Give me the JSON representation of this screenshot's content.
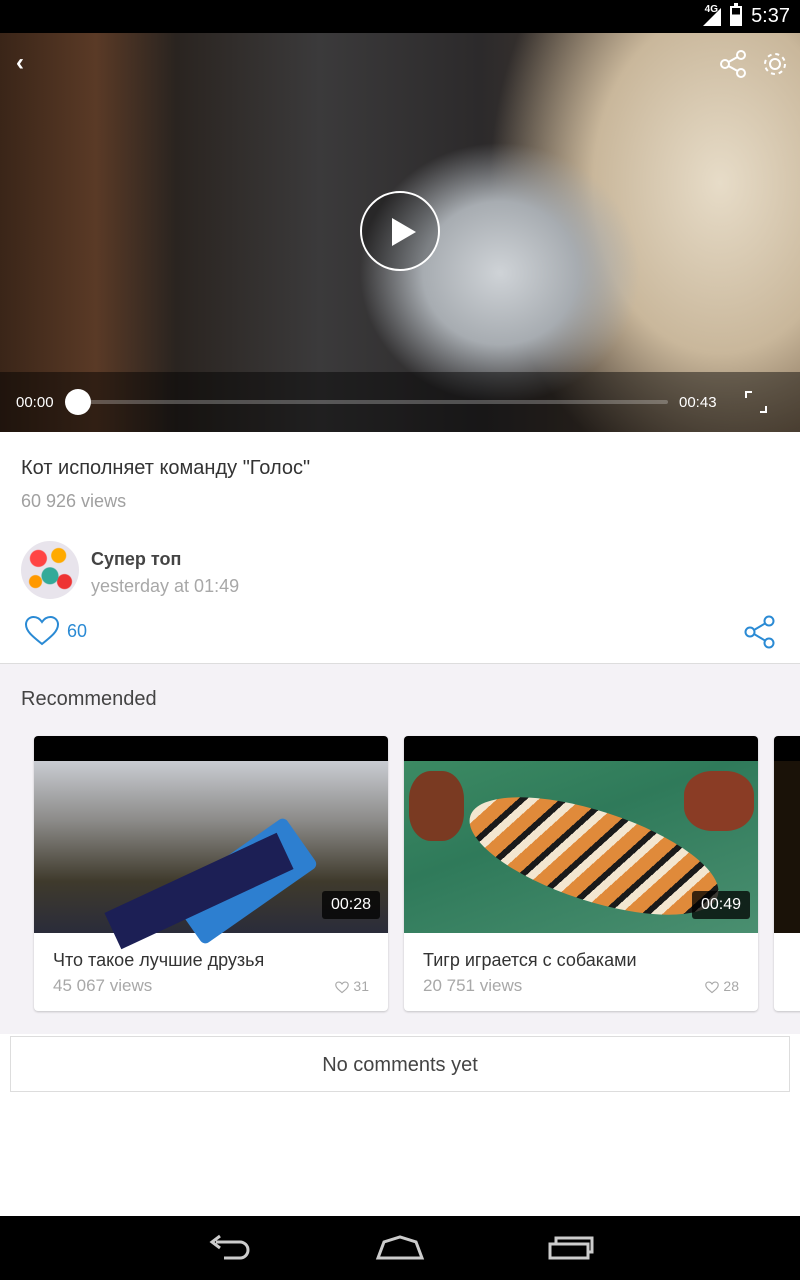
{
  "status_bar": {
    "network": "4G",
    "time": "5:37"
  },
  "player": {
    "current_time": "00:00",
    "duration": "00:43",
    "progress": 0
  },
  "video": {
    "title": "Кот исполняет команду \"Голос\"",
    "views": "60 926  views",
    "author": "Супер топ",
    "posted": "yesterday at 01:49",
    "likes": "60"
  },
  "recommended": {
    "heading": "Recommended",
    "items": [
      {
        "title": "Что такое лучшие друзья",
        "views": "45 067  views",
        "likes": "31",
        "duration": "00:28"
      },
      {
        "title": "Тигр играется с собаками",
        "views": "20 751  views",
        "likes": "28",
        "duration": "00:49"
      }
    ]
  },
  "comments": {
    "empty_text": "No comments yet"
  },
  "colors": {
    "accent": "#2a8ad4",
    "background": "#ffffff",
    "section_bg": "#f4f2f6"
  }
}
